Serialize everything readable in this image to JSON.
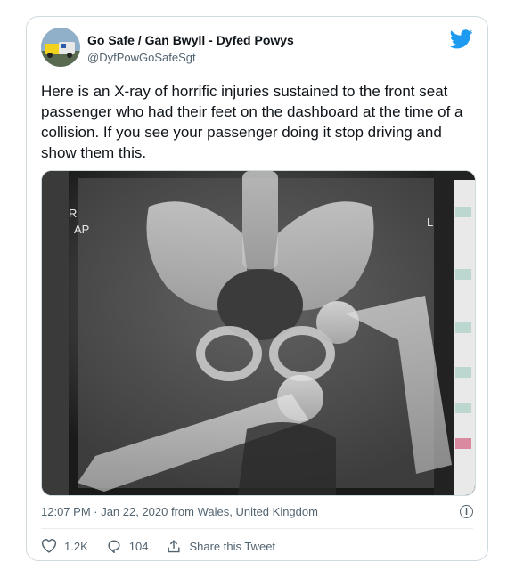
{
  "tweet": {
    "display_name": "Go Safe / Gan Bwyll - Dyfed Powys",
    "handle": "@DyfPowGoSafeSgt",
    "text": "Here is an X-ray of horrific injuries sustained to the front seat passenger who had their feet on the dashboard at the time of a collision. If you see your passenger doing it stop driving and show them this.",
    "timestamp": "12:07 PM · Jan 22, 2020 from Wales, United Kingdom",
    "likes": "1.2K",
    "replies": "104",
    "share_label": "Share this Tweet",
    "info_glyph": "i"
  },
  "xray": {
    "marker_left": "R",
    "marker_view": "AP",
    "marker_right": "L"
  },
  "icons": [
    "twitter-bird-icon",
    "heart-icon",
    "reply-icon",
    "share-icon",
    "info-icon"
  ],
  "colors": {
    "brand_blue": "#1d9bf0",
    "text": "#0f1419",
    "muted": "#536471",
    "border": "#cfd9de"
  }
}
